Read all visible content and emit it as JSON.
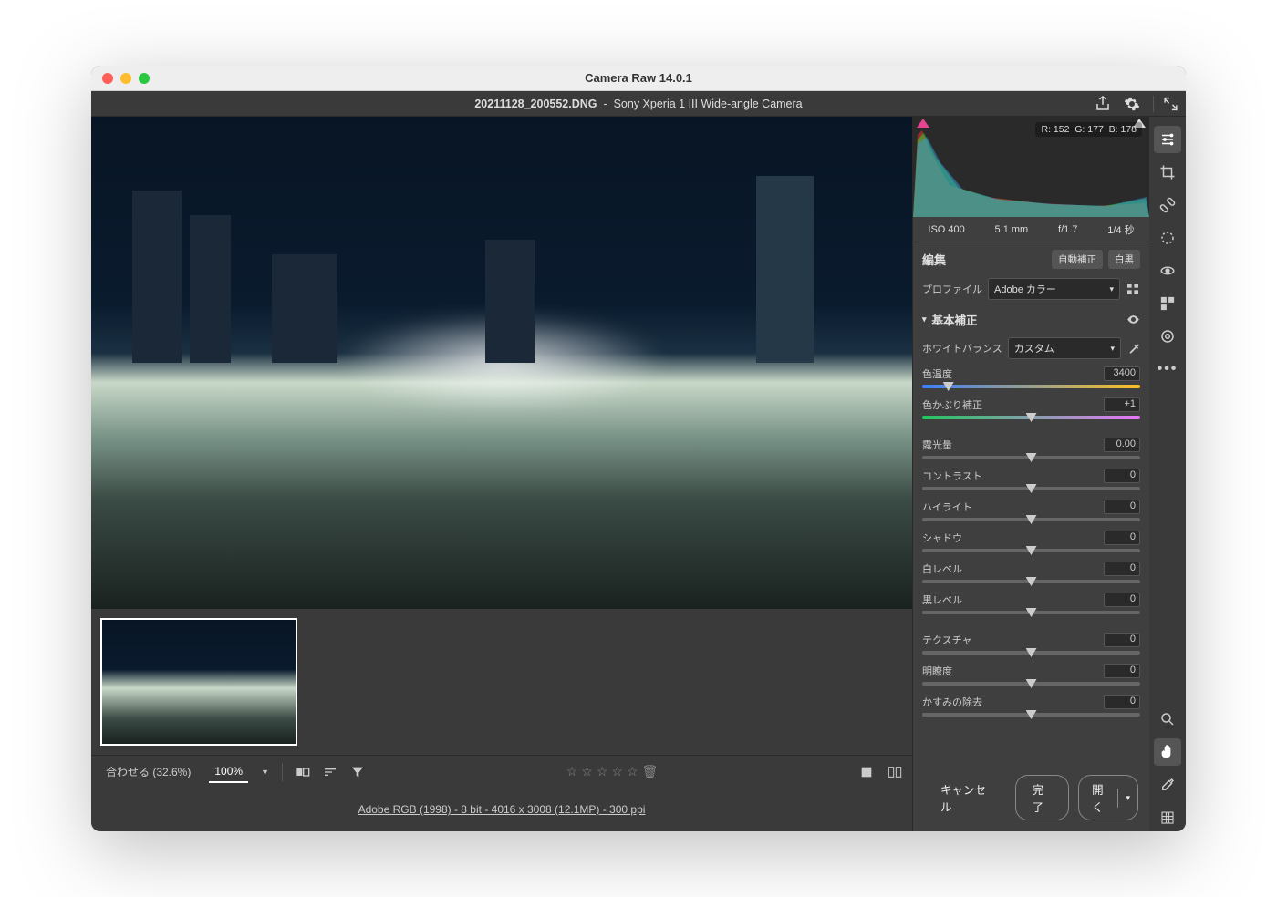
{
  "window_title": "Camera Raw 14.0.1",
  "header": {
    "filename": "20211128_200552.DNG",
    "camera": "Sony Xperia 1 III Wide-angle Camera"
  },
  "toolbar": {
    "fit_label": "合わせる (32.6%)",
    "zoom100": "100%"
  },
  "footer": {
    "workflow": "Adobe RGB (1998) - 8 bit - 4016 x 3008 (12.1MP) - 300 ppi",
    "cancel": "キャンセル",
    "done": "完了",
    "open": "開く"
  },
  "histogram": {
    "rgb": {
      "r": "R: 152",
      "g": "G: 177",
      "b": "B: 178"
    }
  },
  "meta": {
    "iso": "ISO 400",
    "focal": "5.1 mm",
    "aperture": "f/1.7",
    "shutter": "1/4 秒"
  },
  "edit": {
    "title": "編集",
    "auto": "自動補正",
    "bw": "白黒",
    "profile_label": "プロファイル",
    "profile_value": "Adobe カラー",
    "basic": {
      "title": "基本補正",
      "wb_label": "ホワイトバランス",
      "wb_value": "カスタム",
      "temperature": {
        "label": "色温度",
        "value": "3400"
      },
      "tint": {
        "label": "色かぶり補正",
        "value": "+1"
      },
      "exposure": {
        "label": "露光量",
        "value": "0.00"
      },
      "contrast": {
        "label": "コントラスト",
        "value": "0"
      },
      "highlights": {
        "label": "ハイライト",
        "value": "0"
      },
      "shadows": {
        "label": "シャドウ",
        "value": "0"
      },
      "whites": {
        "label": "白レベル",
        "value": "0"
      },
      "blacks": {
        "label": "黒レベル",
        "value": "0"
      },
      "texture": {
        "label": "テクスチャ",
        "value": "0"
      },
      "clarity": {
        "label": "明瞭度",
        "value": "0"
      },
      "dehaze": {
        "label": "かすみの除去",
        "value": "0"
      }
    }
  }
}
